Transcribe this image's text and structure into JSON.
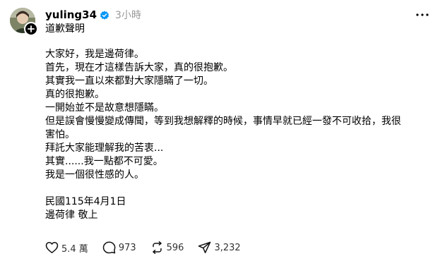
{
  "post": {
    "username": "yuling34",
    "timestamp": "3小時",
    "title": "道歉聲明",
    "paragraph1": [
      "大家好，我是邊荷律。",
      "首先，現在才這樣告訴大家，真的很抱歉。",
      "其實我一直以來都對大家隱瞞了一切。",
      "真的很抱歉。",
      "一開始並不是故意想隱瞞。",
      "但是誤會慢慢變成傳聞，等到我想解釋的時候，事情早就已經一發不可收拾，我很",
      "害怕。",
      "拜託大家能理解我的苦衷...",
      "其實......我一點都不可愛。",
      "我是一個很性感的人。"
    ],
    "paragraph2": [
      "民國115年4月1日",
      "邊荷律 敬上"
    ]
  },
  "actions": {
    "likes": "5.4 萬",
    "comments": "973",
    "reposts": "596",
    "shares": "3,232"
  },
  "icons": {
    "verified": "verified-badge-icon",
    "more": "more-icon",
    "like": "heart-icon",
    "comment": "comment-icon",
    "repost": "repost-icon",
    "share": "send-icon",
    "follow": "plus-icon"
  },
  "colors": {
    "verified": "#0095f6",
    "timestamp": "#999999",
    "text": "#000000"
  }
}
